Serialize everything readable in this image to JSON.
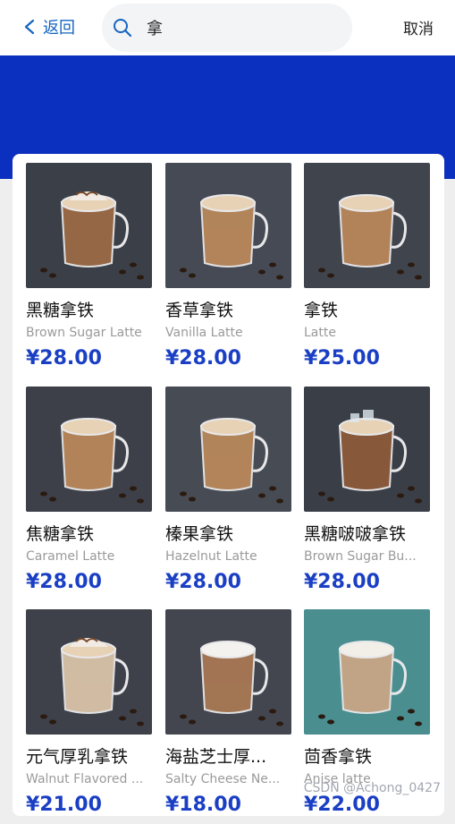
{
  "header": {
    "back_label": "返回",
    "search_value": "拿",
    "cancel_label": "取消"
  },
  "colors": {
    "accent": "#1565c0",
    "banner": "#0b2fbe",
    "price": "#1a3fc4"
  },
  "products": [
    {
      "name": "黑糖拿铁",
      "en": "Brown Sugar Latte",
      "price": "¥28.00",
      "image": "iced-latte-whipped-cream",
      "bg": "#3b3f48"
    },
    {
      "name": "香草拿铁",
      "en": "Vanilla Latte",
      "price": "¥28.00",
      "image": "latte-art-mug",
      "bg": "#454a54"
    },
    {
      "name": "拿铁",
      "en": "Latte",
      "price": "¥25.00",
      "image": "latte-art-heart",
      "bg": "#40444d"
    },
    {
      "name": "焦糖拿铁",
      "en": "Caramel Latte",
      "price": "¥28.00",
      "image": "latte-art-caramel",
      "bg": "#3d4049"
    },
    {
      "name": "榛果拿铁",
      "en": "Hazelnut Latte",
      "price": "¥28.00",
      "image": "latte-hazelnut",
      "bg": "#474b54"
    },
    {
      "name": "黑糖啵啵拿铁",
      "en": "Brown Sugar Bu...",
      "price": "¥28.00",
      "image": "iced-boba-latte",
      "bg": "#3a3e46"
    },
    {
      "name": "元气厚乳拿铁",
      "en": "Walnut Flavored ...",
      "price": "¥21.00",
      "image": "layered-latte-cream",
      "bg": "#3e414a"
    },
    {
      "name": "海盐芝士厚...",
      "en": "Salty Cheese Ne...",
      "price": "¥18.00",
      "image": "cheese-foam-latte",
      "bg": "#43464f"
    },
    {
      "name": "茴香拿铁",
      "en": "Anise latte",
      "price": "¥22.00",
      "image": "glass-latte-teal",
      "bg": "#4a8e90"
    }
  ],
  "watermark": "CSDN @Achong_0427"
}
